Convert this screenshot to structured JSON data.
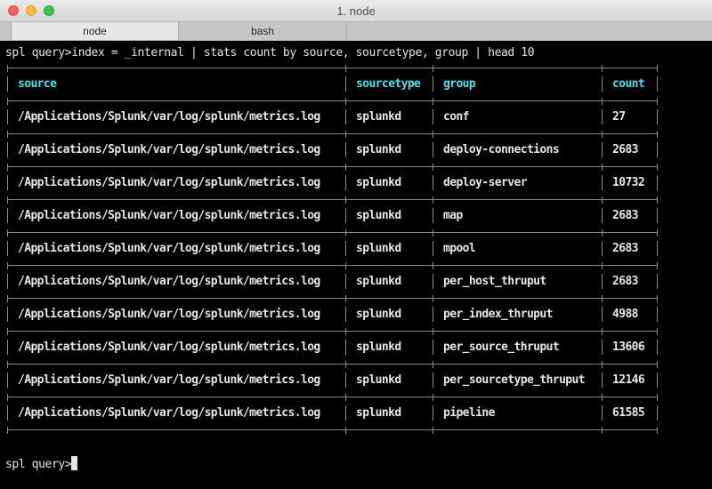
{
  "window": {
    "title": "1. node",
    "tabs": [
      {
        "label": "node",
        "active": true
      },
      {
        "label": "bash",
        "active": false
      }
    ]
  },
  "terminal": {
    "command_line": "spl query>index = _internal | stats count by source, sourcetype, group | head 10",
    "prompt": "spl query>",
    "colors": {
      "background": "#000000",
      "text": "#e6e6e6",
      "header": "#4fe0e8",
      "border": "#8a8a8a"
    },
    "table": {
      "headers": [
        "source",
        "sourcetype",
        "group",
        "count"
      ],
      "rows": [
        [
          "/Applications/Splunk/var/log/splunk/metrics.log",
          "splunkd",
          "conf",
          "27"
        ],
        [
          "/Applications/Splunk/var/log/splunk/metrics.log",
          "splunkd",
          "deploy-connections",
          "2683"
        ],
        [
          "/Applications/Splunk/var/log/splunk/metrics.log",
          "splunkd",
          "deploy-server",
          "10732"
        ],
        [
          "/Applications/Splunk/var/log/splunk/metrics.log",
          "splunkd",
          "map",
          "2683"
        ],
        [
          "/Applications/Splunk/var/log/splunk/metrics.log",
          "splunkd",
          "mpool",
          "2683"
        ],
        [
          "/Applications/Splunk/var/log/splunk/metrics.log",
          "splunkd",
          "per_host_thruput",
          "2683"
        ],
        [
          "/Applications/Splunk/var/log/splunk/metrics.log",
          "splunkd",
          "per_index_thruput",
          "4988"
        ],
        [
          "/Applications/Splunk/var/log/splunk/metrics.log",
          "splunkd",
          "per_source_thruput",
          "13606"
        ],
        [
          "/Applications/Splunk/var/log/splunk/metrics.log",
          "splunkd",
          "per_sourcetype_thruput",
          "12146"
        ],
        [
          "/Applications/Splunk/var/log/splunk/metrics.log",
          "splunkd",
          "pipeline",
          "61585"
        ]
      ]
    }
  }
}
